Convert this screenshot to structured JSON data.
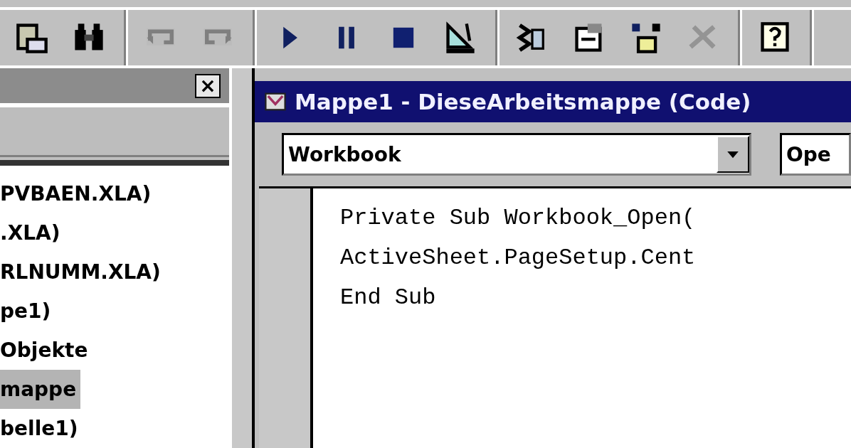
{
  "toolbar": {
    "groups": [
      [
        {
          "disabled": false
        },
        {
          "disabled": false
        }
      ],
      [
        {
          "disabled": true
        },
        {
          "disabled": true
        }
      ],
      [
        {
          "disabled": false
        },
        {
          "disabled": false
        },
        {
          "disabled": false
        },
        {
          "disabled": false
        }
      ],
      [
        {
          "disabled": false
        },
        {
          "disabled": false
        },
        {
          "disabled": false
        },
        {
          "disabled": true
        }
      ],
      [
        {
          "disabled": false
        }
      ]
    ]
  },
  "project_pane": {
    "close": "×",
    "items": [
      {
        "label": "PVBAEN.XLA)",
        "selected": false
      },
      {
        "label": ".XLA)",
        "selected": false
      },
      {
        "label": "RLNUMM.XLA)",
        "selected": false
      },
      {
        "label": "pe1)",
        "selected": false
      },
      {
        "label": "Objekte",
        "selected": false
      },
      {
        "label": "mappe",
        "selected": true
      },
      {
        "label": "belle1)",
        "selected": false
      }
    ]
  },
  "code_window": {
    "title": "Mappe1 - DieseArbeitsmappe (Code)",
    "object_combo": "Workbook",
    "procedure_combo": "Ope",
    "lines": [
      "Private Sub Workbook_Open(",
      "ActiveSheet.PageSetup.Cent",
      "End Sub"
    ]
  }
}
